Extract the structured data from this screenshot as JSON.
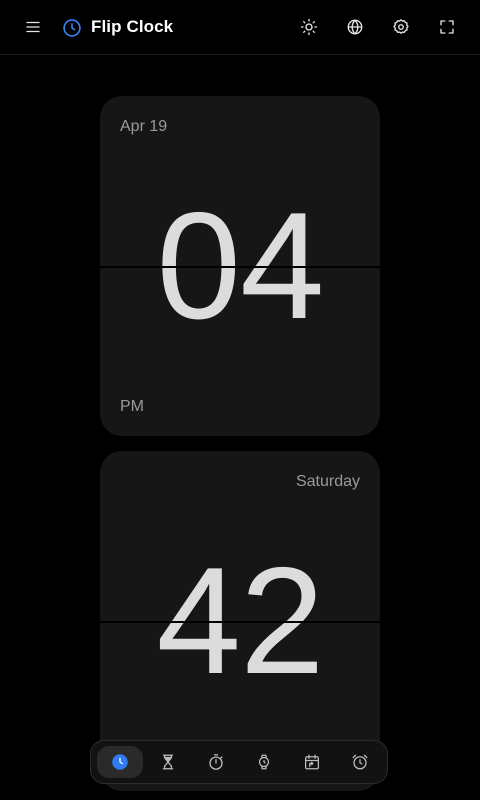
{
  "app": {
    "title": "Flip Clock"
  },
  "header": {
    "icons": [
      "menu-icon",
      "clock-logo-icon",
      "sun-icon",
      "globe-icon",
      "gear-icon",
      "fullscreen-icon"
    ]
  },
  "clock": {
    "hour": "04",
    "minute": "42",
    "date": "Apr 19",
    "period": "PM",
    "weekday": "Saturday"
  },
  "bottom_nav": {
    "items": [
      {
        "icon": "clock-icon",
        "active": true
      },
      {
        "icon": "hourglass-icon",
        "active": false
      },
      {
        "icon": "stopwatch-icon",
        "active": false
      },
      {
        "icon": "watch-icon",
        "active": false
      },
      {
        "icon": "calendar-arrow-icon",
        "active": false
      },
      {
        "icon": "alarm-clock-icon",
        "active": false
      }
    ]
  },
  "colors": {
    "background": "#000000",
    "card": "#161616",
    "accent": "#3b82f6",
    "digits": "#dcdcdc"
  }
}
